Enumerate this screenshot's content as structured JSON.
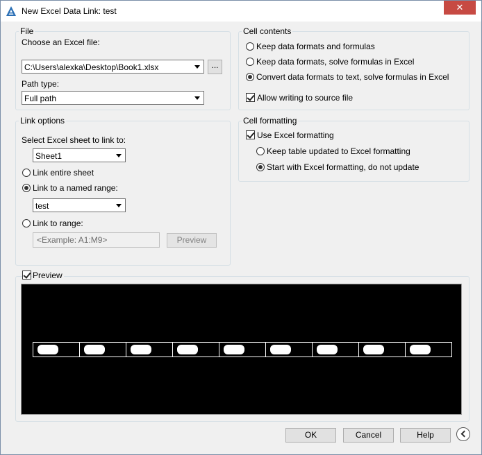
{
  "window": {
    "title": "New Excel Data Link: test",
    "close_glyph": "✕"
  },
  "file": {
    "group_label": "File",
    "choose_label": "Choose an Excel file:",
    "file_path": "C:\\Users\\alexka\\Desktop\\Book1.xlsx",
    "browse_label": "...",
    "path_type_label": "Path type:",
    "path_type_value": "Full path"
  },
  "link_options": {
    "group_label": "Link options",
    "sheet_label": "Select Excel sheet to link to:",
    "sheet_value": "Sheet1",
    "entire_sheet_label": "Link entire sheet",
    "named_range_label": "Link to a named range:",
    "named_range_value": "test",
    "range_label": "Link to range:",
    "range_placeholder": "<Example: A1:M9>",
    "preview_button_label": "Preview",
    "selected": "named_range"
  },
  "cell_contents": {
    "group_label": "Cell contents",
    "options": [
      {
        "label": "Keep data formats and formulas",
        "selected": false
      },
      {
        "label": "Keep data formats, solve formulas in Excel",
        "selected": false
      },
      {
        "label": "Convert data formats to text, solve formulas in Excel",
        "selected": true
      }
    ],
    "allow_writing_label": "Allow writing to source file",
    "allow_writing_checked": true
  },
  "cell_formatting": {
    "group_label": "Cell formatting",
    "use_excel_label": "Use Excel formatting",
    "use_excel_checked": true,
    "options": [
      {
        "label": "Keep table updated to Excel formatting",
        "selected": false
      },
      {
        "label": "Start with Excel formatting, do not update",
        "selected": true
      }
    ]
  },
  "preview": {
    "label": "Preview",
    "checked": true,
    "column_count": 9
  },
  "footer": {
    "ok_label": "OK",
    "cancel_label": "Cancel",
    "help_label": "Help"
  },
  "colors": {
    "close_button": "#c74a43",
    "dialog_bg": "#f0f0f0",
    "preview_bg": "#000000",
    "app_icon": "#2a6fb5"
  }
}
